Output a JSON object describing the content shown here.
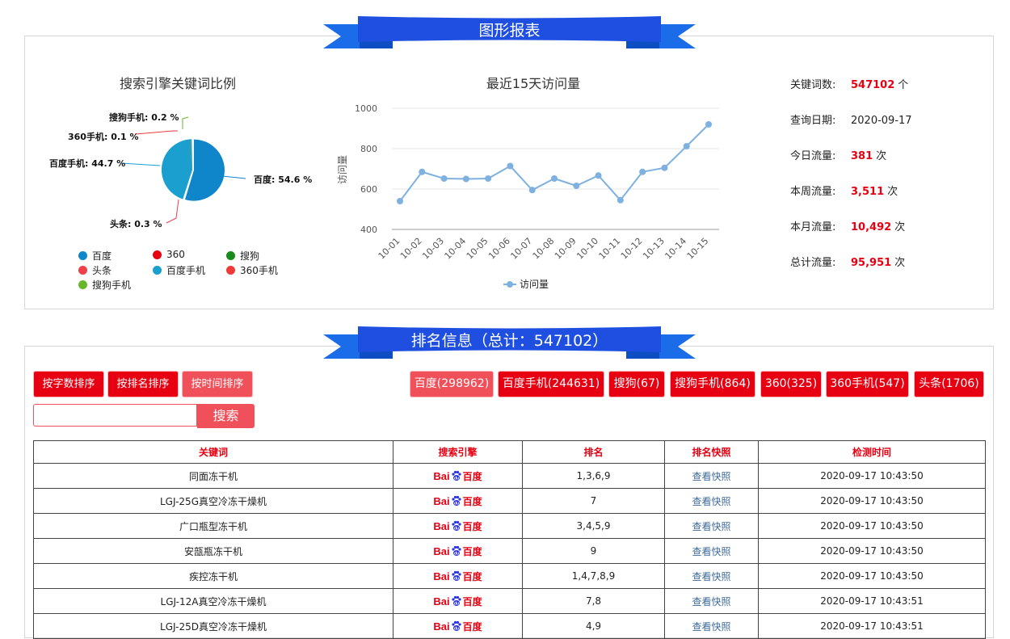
{
  "chart_section": {
    "ribbon_title": "图形报表",
    "pie": {
      "title": "搜索引擎关键词比例",
      "slice_labels": [
        "搜狗手机: 0.2 %",
        "360手机: 0.1 %",
        "百度手机: 44.7 %",
        "百度: 54.6 %",
        "头条: 0.3 %"
      ],
      "legend": [
        {
          "name": "百度",
          "color": "#0f86c9"
        },
        {
          "name": "360",
          "color": "#e60012"
        },
        {
          "name": "搜狗",
          "color": "#1a8a1a"
        },
        {
          "name": "头条",
          "color": "#f0404a"
        },
        {
          "name": "百度手机",
          "color": "#1a9fcf"
        },
        {
          "name": "360手机",
          "color": "#f03a3a"
        },
        {
          "name": "搜狗手机",
          "color": "#66b82a"
        }
      ]
    },
    "stats": [
      {
        "label": "关键词数:",
        "value": "547102",
        "unit": "个",
        "highlight": true
      },
      {
        "label": "查询日期:",
        "value": "2020-09-17",
        "unit": "",
        "highlight": false
      },
      {
        "label": "今日流量:",
        "value": "381",
        "unit": "次",
        "highlight": true
      },
      {
        "label": "本周流量:",
        "value": "3,511",
        "unit": "次",
        "highlight": true
      },
      {
        "label": "本月流量:",
        "value": "10,492",
        "unit": "次",
        "highlight": true
      },
      {
        "label": "总计流量:",
        "value": "95,951",
        "unit": "次",
        "highlight": true
      }
    ]
  },
  "chart_data": [
    {
      "type": "pie",
      "title": "搜索引擎关键词比例",
      "categories": [
        "百度",
        "360",
        "搜狗",
        "头条",
        "百度手机",
        "360手机",
        "搜狗手机"
      ],
      "values": [
        54.6,
        0,
        0,
        0.3,
        44.7,
        0.1,
        0.2
      ],
      "colors": [
        "#0f86c9",
        "#e60012",
        "#1a8a1a",
        "#f0404a",
        "#1a9fcf",
        "#f03a3a",
        "#66b82a"
      ],
      "legend_position": "bottom"
    },
    {
      "type": "line",
      "title": "最近15天访问量",
      "ylabel": "访问量",
      "xlabel": "",
      "categories": [
        "10-01",
        "10-02",
        "10-03",
        "10-04",
        "10-05",
        "10-06",
        "10-07",
        "10-08",
        "10-09",
        "10-10",
        "10-11",
        "10-12",
        "10-13",
        "10-14",
        "10-15"
      ],
      "series": [
        {
          "name": "访问量",
          "values": [
            540,
            685,
            652,
            650,
            652,
            714,
            595,
            652,
            616,
            667,
            545,
            685,
            705,
            812,
            920
          ]
        }
      ],
      "ylim": [
        400,
        1000
      ],
      "yticks": [
        400,
        600,
        800,
        1000
      ],
      "grid": true,
      "legend_position": "bottom",
      "color": "#7eb1e0"
    }
  ],
  "ranking_section": {
    "ribbon_title": "排名信息（总计：547102）",
    "sort_buttons": [
      "按字数排序",
      "按排名排序",
      "按时间排序"
    ],
    "filter_buttons": [
      "百度(298962)",
      "百度手机(244631)",
      "搜狗(67)",
      "搜狗手机(864)",
      "360(325)",
      "360手机(547)",
      "头条(1706)"
    ],
    "search": {
      "value": "",
      "button": "搜索"
    },
    "table": {
      "headers": [
        "关键词",
        "搜索引擎",
        "排名",
        "排名快照",
        "检测时间"
      ],
      "engine_logo": {
        "left": "Bai",
        "right": "百度"
      },
      "rows": [
        {
          "keyword": "同面冻干机",
          "rank": "1,3,6,9",
          "snapshot": "查看快照",
          "time": "2020-09-17 10:43:50"
        },
        {
          "keyword": "LGJ-25G真空冷冻干燥机",
          "rank": "7",
          "snapshot": "查看快照",
          "time": "2020-09-17 10:43:50"
        },
        {
          "keyword": "广口瓶型冻干机",
          "rank": "3,4,5,9",
          "snapshot": "查看快照",
          "time": "2020-09-17 10:43:50"
        },
        {
          "keyword": "安瓿瓶冻干机",
          "rank": "9",
          "snapshot": "查看快照",
          "time": "2020-09-17 10:43:50"
        },
        {
          "keyword": "疾控冻干机",
          "rank": "1,4,7,8,9",
          "snapshot": "查看快照",
          "time": "2020-09-17 10:43:50"
        },
        {
          "keyword": "LGJ-12A真空冷冻干燥机",
          "rank": "7,8",
          "snapshot": "查看快照",
          "time": "2020-09-17 10:43:51"
        },
        {
          "keyword": "LGJ-25D真空冷冻干燥机",
          "rank": "4,9",
          "snapshot": "查看快照",
          "time": "2020-09-17 10:43:51"
        }
      ]
    }
  }
}
